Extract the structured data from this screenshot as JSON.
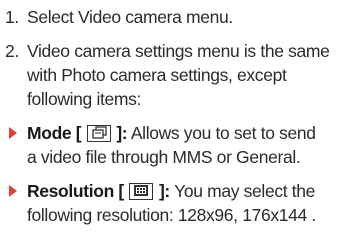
{
  "steps": [
    {
      "number": "1.",
      "text": "Select Video camera menu."
    },
    {
      "number": "2.",
      "line1": "Video camera settings menu is the same",
      "line2": "with Photo camera settings, except",
      "line3": "following items:"
    }
  ],
  "items": [
    {
      "label": "Mode [",
      "label_end": "]:",
      "icon": "mode-icon",
      "desc_line1": " Allows you to set to send",
      "desc_line2": "a video file through MMS or General."
    },
    {
      "label": "Resolution [",
      "label_end": "]:",
      "icon": "resolution-icon",
      "desc_line1": " You may select the",
      "desc_line2": "following resolution: 128x96, 176x144 ."
    }
  ],
  "colors": {
    "bullet": "#e0403a",
    "text": "#2b2b2b"
  }
}
